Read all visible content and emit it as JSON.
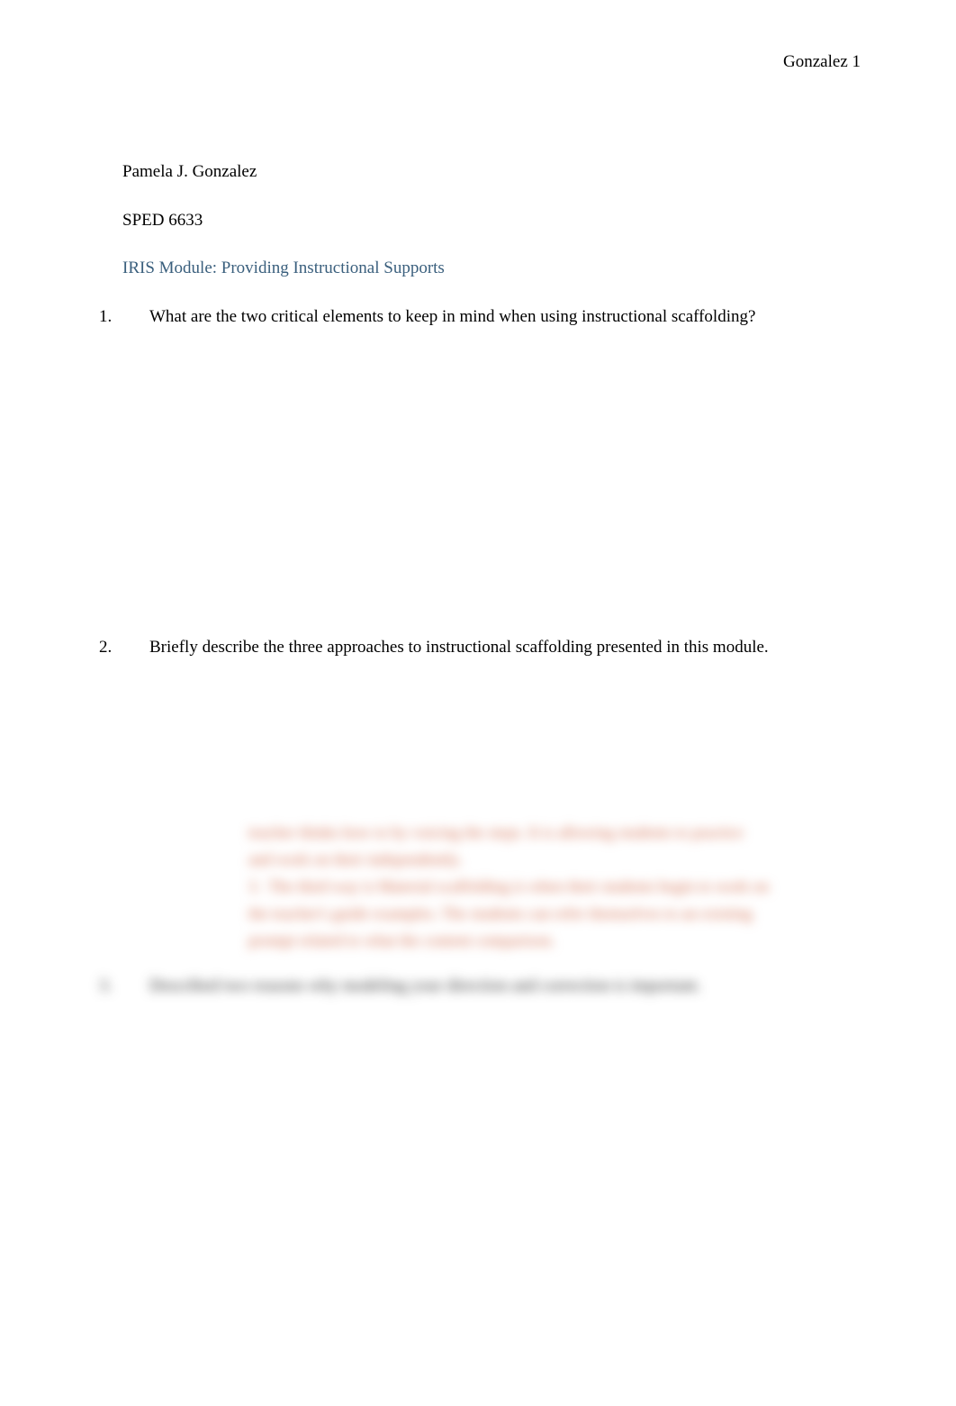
{
  "header": {
    "running_head": "Gonzalez 1"
  },
  "document": {
    "author": "Pamela J. Gonzalez",
    "course": "SPED 6633",
    "module_title": "IRIS Module: Providing Instructional Supports"
  },
  "questions": [
    {
      "number": "1.",
      "text": "What are the two critical elements to keep in mind when using instructional scaffolding?"
    },
    {
      "number": "2.",
      "text": "Briefly describe the three approaches to instructional scaffolding presented in this module."
    }
  ],
  "blurred": {
    "line1": "teacher thinks how to by voicing the steps. It is allowing students to practice",
    "line2": "and work on their independently.",
    "bullet_num": "3.",
    "line3": "The third way is Material scaffolding is when their students begin to work on",
    "line4": "the teacher's guide examples. The students can refer themselves to an existing",
    "line5": "prompt related to what the content comparison.",
    "q3_num": "3.",
    "q3_text": "Described two reasons why modeling your direction and correction is important."
  }
}
